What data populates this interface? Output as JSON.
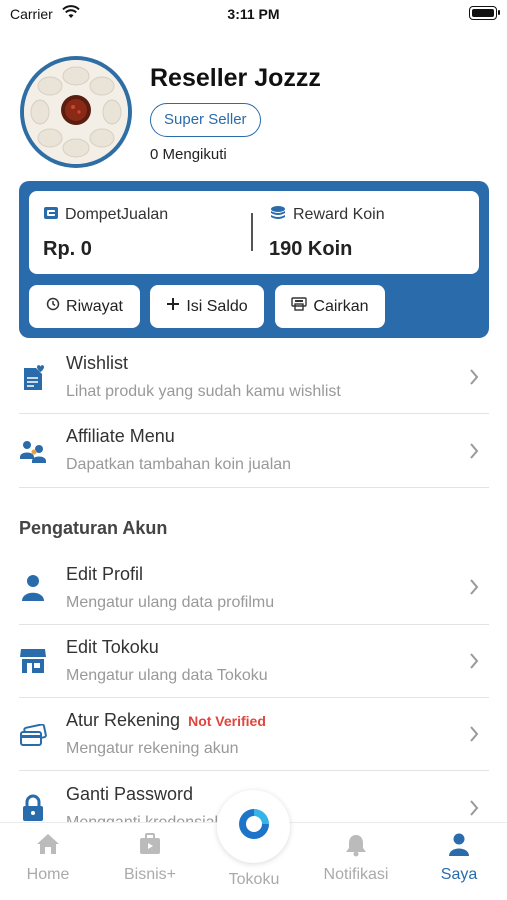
{
  "status_bar": {
    "carrier": "Carrier",
    "time": "3:11 PM"
  },
  "profile": {
    "name": "Reseller Jozzz",
    "badge": "Super Seller",
    "following": "0 Mengikuti"
  },
  "wallet": {
    "dompet": {
      "label": "DompetJualan",
      "value": "Rp. 0"
    },
    "reward": {
      "label": "Reward Koin",
      "value": "190 Koin"
    },
    "buttons": {
      "history": "Riwayat",
      "topup": "Isi Saldo",
      "withdraw": "Cairkan"
    }
  },
  "menu": [
    {
      "title": "Wishlist",
      "subtitle": "Lihat produk yang sudah kamu wishlist"
    },
    {
      "title": "Affiliate Menu",
      "subtitle": "Dapatkan tambahan koin jualan"
    }
  ],
  "account_section": {
    "heading": "Pengaturan Akun",
    "items": [
      {
        "title": "Edit Profil",
        "subtitle": "Mengatur ulang data profilmu"
      },
      {
        "title": "Edit Tokoku",
        "subtitle": "Mengatur ulang data Tokoku"
      },
      {
        "title": "Atur Rekening",
        "tag": "Not Verified",
        "subtitle": "Mengatur rekening akun"
      },
      {
        "title": "Ganti Password",
        "subtitle": "Mengganti kredensial akunmu"
      }
    ]
  },
  "bottom_nav": {
    "items": [
      "Home",
      "Bisnis+",
      "Tokoku",
      "Notifikasi",
      "Saya"
    ],
    "active": "Saya"
  },
  "colors": {
    "primary": "#2a6cab",
    "warning": "#e0443c",
    "muted": "#aaaaaa"
  }
}
